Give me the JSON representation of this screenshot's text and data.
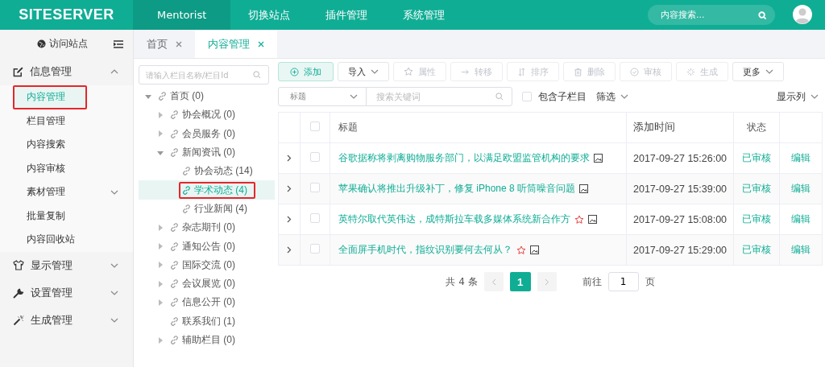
{
  "header": {
    "logo": "SITESERVER",
    "nav": [
      {
        "label": "Mentorist",
        "selected": true
      },
      {
        "label": "切换站点",
        "selected": false
      },
      {
        "label": "插件管理",
        "selected": false
      },
      {
        "label": "系统管理",
        "selected": false
      }
    ],
    "search": {
      "placeholder": "内容搜索..."
    }
  },
  "sidebar": {
    "visit_site": "访问站点",
    "groups": [
      {
        "label": "信息管理",
        "kind": "edit",
        "expanded": true,
        "children": [
          {
            "label": "内容管理",
            "kind": "link",
            "selected": true,
            "annotated": true
          },
          {
            "label": "栏目管理",
            "kind": "link",
            "selected": false,
            "annotated": false
          },
          {
            "label": "内容搜索",
            "kind": "link",
            "selected": false,
            "annotated": false
          },
          {
            "label": "内容审核",
            "kind": "link",
            "selected": false,
            "annotated": false
          },
          {
            "label": "素材管理",
            "kind": "submenu",
            "selected": false,
            "annotated": false
          },
          {
            "label": "批量复制",
            "kind": "link",
            "selected": false,
            "annotated": false
          },
          {
            "label": "内容回收站",
            "kind": "link",
            "selected": false,
            "annotated": false
          }
        ]
      },
      {
        "label": "显示管理",
        "kind": "shirt",
        "expanded": false
      },
      {
        "label": "设置管理",
        "kind": "wrench",
        "expanded": false
      },
      {
        "label": "生成管理",
        "kind": "wand",
        "expanded": false
      }
    ]
  },
  "tabs": [
    {
      "label": "首页",
      "selected": false
    },
    {
      "label": "内容管理",
      "selected": true
    }
  ],
  "tree": {
    "placeholder": "请输入栏目名称/栏目Id",
    "nodes": [
      {
        "label": "首页 (0)",
        "kind": "branch",
        "expanded": true,
        "selected": false,
        "annotated": false,
        "children": [
          {
            "label": "协会概况 (0)",
            "kind": "branch",
            "expanded": false,
            "selected": false,
            "annotated": false
          },
          {
            "label": "会员服务 (0)",
            "kind": "branch",
            "expanded": false,
            "selected": false,
            "annotated": false
          },
          {
            "label": "新闻资讯 (0)",
            "kind": "branch",
            "expanded": true,
            "selected": false,
            "annotated": false,
            "children": [
              {
                "label": "协会动态 (14)",
                "kind": "leaf",
                "selected": false,
                "annotated": false
              },
              {
                "label": "学术动态 (4)",
                "kind": "leaf",
                "selected": true,
                "annotated": true
              },
              {
                "label": "行业新闻 (4)",
                "kind": "leaf",
                "selected": false,
                "annotated": false
              }
            ]
          },
          {
            "label": "杂志期刊 (0)",
            "kind": "branch",
            "expanded": false,
            "selected": false,
            "annotated": false
          },
          {
            "label": "通知公告 (0)",
            "kind": "branch",
            "expanded": false,
            "selected": false,
            "annotated": false
          },
          {
            "label": "国际交流 (0)",
            "kind": "branch",
            "expanded": false,
            "selected": false,
            "annotated": false
          },
          {
            "label": "会议展览 (0)",
            "kind": "branch",
            "expanded": false,
            "selected": false,
            "annotated": false
          },
          {
            "label": "信息公开 (0)",
            "kind": "branch",
            "expanded": false,
            "selected": false,
            "annotated": false
          },
          {
            "label": "联系我们 (1)",
            "kind": "leaf",
            "selected": false,
            "annotated": false
          },
          {
            "label": "辅助栏目 (0)",
            "kind": "branch",
            "expanded": false,
            "selected": false,
            "annotated": false
          }
        ]
      }
    ]
  },
  "toolbar": [
    {
      "label": "添加",
      "kind": "add",
      "disabled": false
    },
    {
      "label": "导入",
      "kind": "dropdown",
      "disabled": false
    },
    {
      "label": "属性",
      "kind": "star",
      "disabled": true
    },
    {
      "label": "转移",
      "kind": "arrow",
      "disabled": true
    },
    {
      "label": "排序",
      "kind": "sort",
      "disabled": true
    },
    {
      "label": "删除",
      "kind": "trash",
      "disabled": true
    },
    {
      "label": "审核",
      "kind": "check",
      "disabled": true
    },
    {
      "label": "生成",
      "kind": "spark",
      "disabled": true
    },
    {
      "label": "更多",
      "kind": "dropdown",
      "disabled": false
    }
  ],
  "filter": {
    "field": "标题",
    "placeholder": "搜索关键词",
    "include_children": {
      "label": "包含子栏目",
      "checked": false
    },
    "filter_menu": "筛选",
    "columns_menu": "显示列"
  },
  "table": {
    "columns": [
      "标题",
      "添加时间",
      "状态"
    ],
    "header_checked": false,
    "rows": [
      {
        "title": "谷歌据称将剥离购物服务部门，以满足欧盟监管机构的要求",
        "starred": false,
        "time": "2017-09-27 15:26:00",
        "status": "已审核",
        "action": "编辑",
        "checked": false
      },
      {
        "title": "苹果确认将推出升级补丁，修复 iPhone 8 听筒噪音问题",
        "starred": false,
        "time": "2017-09-27 15:39:00",
        "status": "已审核",
        "action": "编辑",
        "checked": false
      },
      {
        "title": "英特尔取代英伟达，成特斯拉车载多媒体系统新合作方",
        "starred": true,
        "time": "2017-09-27 15:08:00",
        "status": "已审核",
        "action": "编辑",
        "checked": false
      },
      {
        "title": "全面屏手机时代，指纹识别要何去何从？",
        "starred": true,
        "time": "2017-09-27 15:29:00",
        "status": "已审核",
        "action": "编辑",
        "checked": false
      }
    ]
  },
  "pagination": {
    "total": "共 4 条",
    "pages": [
      {
        "label": "1",
        "selected": true
      }
    ],
    "goto": "前往",
    "page_input": "1",
    "page_unit": "页"
  }
}
